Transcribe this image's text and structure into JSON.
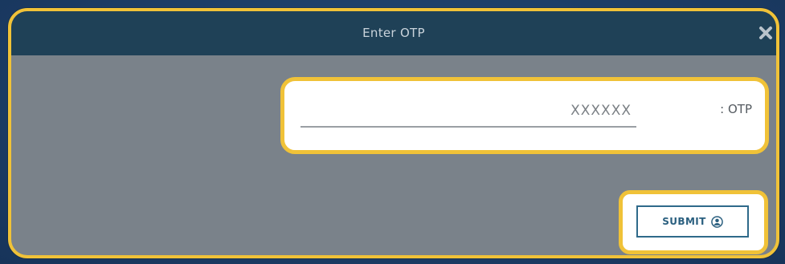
{
  "modal": {
    "title": "Enter OTP",
    "close_icon": "close-icon"
  },
  "otp": {
    "label": ": OTP",
    "placeholder": "XXXXXX",
    "value": ""
  },
  "submit": {
    "label": "SUBMIT",
    "icon": "user-circle-icon"
  },
  "colors": {
    "background": "#1d3f66",
    "header": "#1f4157",
    "body": "#7a828a",
    "highlight": "#f0c238",
    "button_border": "#2f6a8a"
  }
}
